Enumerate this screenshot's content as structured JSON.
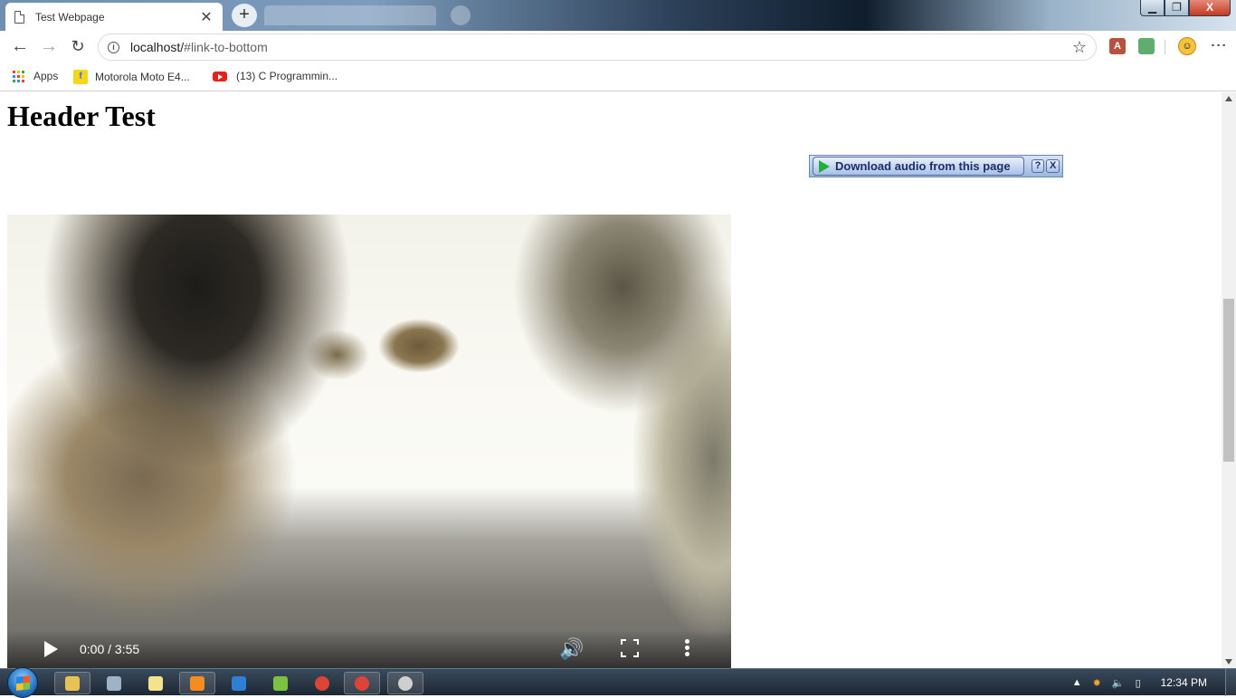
{
  "browser": {
    "tab_title": "Test Webpage",
    "tab_close": "✕",
    "new_tab": "+",
    "url_host": "localhost/",
    "url_rest": "#link-to-bottom",
    "window_controls": {
      "minimize": "▁",
      "restore": "❐",
      "close": "X"
    }
  },
  "bookmarks": [
    {
      "label": "Apps"
    },
    {
      "label": "Motorola Moto E4..."
    },
    {
      "label": "(13) C Programmin..."
    }
  ],
  "page": {
    "heading": "Header Test",
    "download_bar": {
      "label": "Download audio from this page",
      "help": "?",
      "close": "X"
    }
  },
  "video": {
    "time": "0:00 / 3:55"
  },
  "taskbar": {
    "clock": "12:34 PM",
    "items": [
      {
        "name": "explorer",
        "color": "#e8c255"
      },
      {
        "name": "calculator",
        "color": "#9fb3c8"
      },
      {
        "name": "notepad",
        "color": "#f4e28c"
      },
      {
        "name": "sublime-text",
        "color": "#f48c1f"
      },
      {
        "name": "app-blue",
        "color": "#2f7fd4"
      },
      {
        "name": "android-studio",
        "color": "#7cc242"
      },
      {
        "name": "chrome",
        "color": "#db4437"
      },
      {
        "name": "chrome-active",
        "color": "#db4437"
      },
      {
        "name": "app-gray",
        "color": "#cfcfcf"
      }
    ]
  },
  "colors": {
    "link_blue": "#1a2f6b",
    "download_green": "#1faf3a"
  }
}
